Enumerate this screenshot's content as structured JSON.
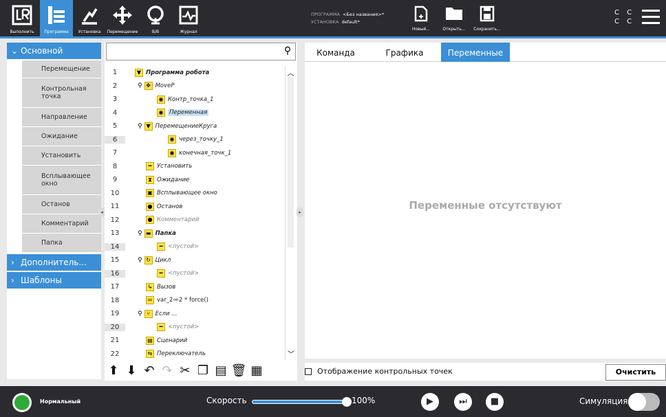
{
  "nav": [
    {
      "label": "Выполнить",
      "icon": "ur-logo-icon"
    },
    {
      "label": "Программа",
      "icon": "program-icon"
    },
    {
      "label": "Установка",
      "icon": "installation-icon"
    },
    {
      "label": "Перемещение",
      "icon": "move-icon"
    },
    {
      "label": "В/В",
      "icon": "io-icon"
    },
    {
      "label": "Журнал",
      "icon": "log-icon"
    }
  ],
  "program_info": {
    "program_label": "ПРОГРАММА",
    "program_value": "<Без названия>*",
    "install_label": "УСТАНОВКА",
    "install_value": "default*"
  },
  "file": {
    "new": "Новый...",
    "open": "Открыть...",
    "save": "Сохранить..."
  },
  "cc": {
    "line1": "C C",
    "line2": "C C"
  },
  "sidebar": {
    "basic": "Основной",
    "items": [
      "Перемещение",
      "Контрольная точка",
      "Направление",
      "Ожидание",
      "Установить",
      "Всплывающее окно",
      "Останов",
      "Комментарий",
      "Папка"
    ],
    "advanced": "Дополнитель...",
    "templates": "Шаблоны"
  },
  "search": {
    "placeholder": ""
  },
  "tree": [
    {
      "n": "1",
      "text": "Программа робота",
      "bold": true,
      "indent": 0,
      "pin": false,
      "icon": "triangle-down-icon"
    },
    {
      "n": "2",
      "text": "MoveP",
      "indent": 1,
      "pin": true,
      "icon": "move-icon"
    },
    {
      "n": "3",
      "text": "Контр_точка_1",
      "indent": 2,
      "pin": false,
      "icon": "waypoint-icon"
    },
    {
      "n": "4",
      "text": "Переменная",
      "indent": 2,
      "pin": false,
      "icon": "waypoint-icon",
      "selected": true
    },
    {
      "n": "5",
      "text": "ПеремещениеКруга",
      "indent": 1,
      "pin": true,
      "icon": "triangle-down-icon"
    },
    {
      "n": "6",
      "text": "через_точку_1",
      "indent": 3,
      "pin": false,
      "icon": "waypoint-icon",
      "alt": true
    },
    {
      "n": "7",
      "text": "конечная_точк_1",
      "indent": 3,
      "pin": false,
      "icon": "waypoint-icon"
    },
    {
      "n": "8",
      "text": "Установить",
      "indent": 1,
      "pin": false,
      "icon": "set-icon"
    },
    {
      "n": "9",
      "text": "Ожидание",
      "indent": 1,
      "pin": false,
      "icon": "hourglass-icon"
    },
    {
      "n": "10",
      "text": "Всплывающее окно",
      "indent": 1,
      "pin": false,
      "icon": "popup-icon"
    },
    {
      "n": "11",
      "text": "Останов",
      "indent": 1,
      "pin": false,
      "icon": "halt-icon"
    },
    {
      "n": "12",
      "text": "Комментарий",
      "indent": 1,
      "pin": false,
      "icon": "comment-icon",
      "gray": true
    },
    {
      "n": "13",
      "text": "Папка",
      "bold": true,
      "indent": 1,
      "pin": true,
      "icon": "folder-icon"
    },
    {
      "n": "14",
      "text": "<пустой>",
      "indent": 2,
      "pin": false,
      "icon": "empty-icon",
      "gray": true,
      "alt": true
    },
    {
      "n": "15",
      "text": "Цикл",
      "indent": 1,
      "pin": true,
      "icon": "loop-icon"
    },
    {
      "n": "16",
      "text": "<пустой>",
      "indent": 2,
      "pin": false,
      "icon": "empty-icon",
      "gray": true,
      "alt": true
    },
    {
      "n": "17",
      "text": "Вызов",
      "indent": 1,
      "pin": false,
      "icon": "call-icon"
    },
    {
      "n": "18",
      "text": "var_2≔2 * force()",
      "indent": 1,
      "pin": false,
      "icon": "assignment-icon",
      "plain": true
    },
    {
      "n": "19",
      "text": "Если ...",
      "indent": 1,
      "pin": true,
      "icon": "if-icon"
    },
    {
      "n": "20",
      "text": "<пустой>",
      "indent": 2,
      "pin": false,
      "icon": "empty-icon",
      "gray": true,
      "alt": true
    },
    {
      "n": "21",
      "text": "Сценарий",
      "indent": 1,
      "pin": false,
      "icon": "script-icon"
    },
    {
      "n": "22",
      "text": "Переключатель",
      "indent": 1,
      "pin": false,
      "icon": "switch-icon"
    }
  ],
  "tabs": [
    "Команда",
    "Графика",
    "Переменные"
  ],
  "main": {
    "empty_text": "Переменные отсутствуют"
  },
  "options": {
    "show_waypoints": "Отображение контрольных точек",
    "clear": "Очистить"
  },
  "footer": {
    "status": "Нормальный",
    "speed_label": "Скорость",
    "speed_value": "100%",
    "speed_fraction": 1.0,
    "sim_label": "Симуляция"
  },
  "colors": {
    "accent": "#3b8fd6",
    "dark": "#2b2b2f",
    "node": "#ffe34a",
    "ok": "#2eaa38"
  }
}
